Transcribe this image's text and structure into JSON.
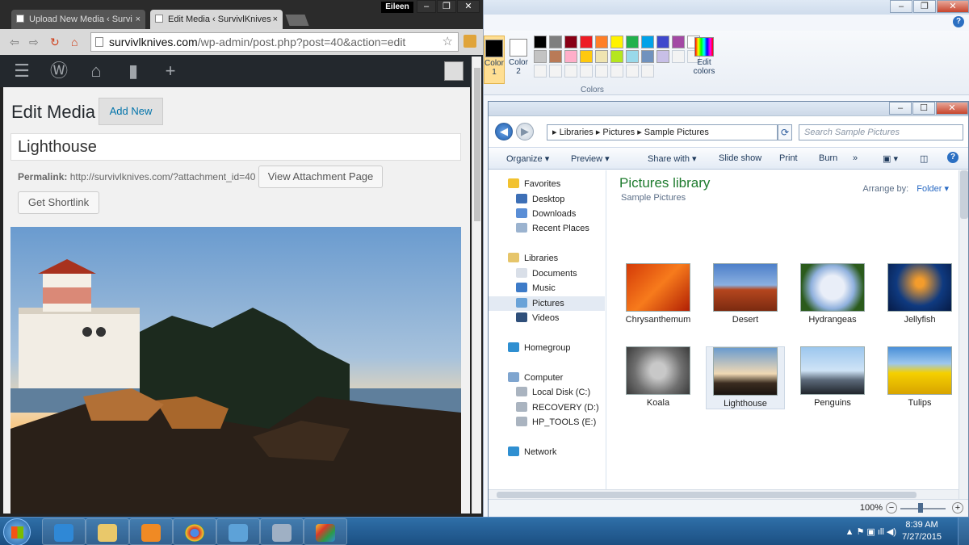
{
  "paint": {
    "color1_label": "Color 1",
    "color2_label": "Color 2",
    "edit_colors_label": "Edit colors",
    "group_label": "Colors",
    "palette": [
      "#000000",
      "#7f7f7f",
      "#880015",
      "#ed1c24",
      "#ff7f27",
      "#fff200",
      "#22b14c",
      "#00a2e8",
      "#3f48cc",
      "#a349a4",
      "#ffffff",
      "#c3c3c3",
      "#b97a57",
      "#ffaec9",
      "#ffc90e",
      "#efe4b0",
      "#b5e61d",
      "#99d9ea",
      "#7092be",
      "#c8bfe7",
      "#f3f3f3",
      "#f3f3f3",
      "#f3f3f3",
      "#f3f3f3",
      "#f3f3f3",
      "#f3f3f3",
      "#f3f3f3",
      "#f3f3f3",
      "#f3f3f3",
      "#f3f3f3"
    ],
    "help_label": "?"
  },
  "explorer": {
    "breadcrumb": "▸  Libraries  ▸  Pictures  ▸  Sample Pictures",
    "search_placeholder": "Search Sample Pictures",
    "toolbar": {
      "organize": "Organize ▾",
      "preview": "Preview ▾",
      "share": "Share with ▾",
      "slideshow": "Slide show",
      "print": "Print",
      "burn": "Burn",
      "more": "»"
    },
    "nav": [
      {
        "label": "Favorites",
        "color": "#f2c230"
      },
      {
        "label": "Desktop",
        "color": "#3d6fb6"
      },
      {
        "label": "Downloads",
        "color": "#5a8ed6"
      },
      {
        "label": "Recent Places",
        "color": "#9bb3cf"
      },
      {
        "label": "Libraries",
        "color": "#e6c56a"
      },
      {
        "label": "Documents",
        "color": "#d9dfe8"
      },
      {
        "label": "Music",
        "color": "#3d7bc8"
      },
      {
        "label": "Pictures",
        "color": "#6aa3d8"
      },
      {
        "label": "Videos",
        "color": "#2f4f7a"
      },
      {
        "label": "Homegroup",
        "color": "#2f8fd1"
      },
      {
        "label": "Computer",
        "color": "#7fa5cf"
      },
      {
        "label": "Local Disk (C:)",
        "color": "#aab4c0"
      },
      {
        "label": "RECOVERY (D:)",
        "color": "#aab4c0"
      },
      {
        "label": "HP_TOOLS (E:)",
        "color": "#aab4c0"
      },
      {
        "label": "Network",
        "color": "#2f8fd1"
      }
    ],
    "library_title": "Pictures library",
    "library_subtitle": "Sample Pictures",
    "arrange_label": "Arrange by:",
    "arrange_value": "Folder ▾",
    "thumbnails": [
      {
        "label": "Chrysanthemum",
        "bg": "linear-gradient(135deg,#d43a08,#f77b1c,#b11f04)"
      },
      {
        "label": "Desert",
        "bg": "linear-gradient(#4d7fc9 0%,#8bb0e0 45%,#b5461e 55%,#7b2a10 100%)"
      },
      {
        "label": "Hydrangeas",
        "bg": "radial-gradient(circle,#e9eef8 30%,#8fb0dd 55%,#2b5b1c 80%)"
      },
      {
        "label": "Jellyfish",
        "bg": "radial-gradient(circle at 50% 40%,#f39c2c 10%,#0f3a80 55%,#061a45 100%)"
      },
      {
        "label": "Koala",
        "bg": "radial-gradient(circle at 50% 50%,#c8c8c8 20%,#6f6f6f 60%,#3a3a3a 100%)"
      },
      {
        "label": "Lighthouse",
        "bg": "linear-gradient(#6a9bcf 0%,#f0d9b4 55%,#3a2c20 75%,#1b1510 100%)"
      },
      {
        "label": "Penguins",
        "bg": "linear-gradient(#9cc7ee 0%,#cfe3f6 50%,#5c6a7a 70%,#20252c 100%)"
      },
      {
        "label": "Tulips",
        "bg": "linear-gradient(#4a8fd8 0%,#9cc7ee 35%,#f5d000 55%,#d8a400 100%)"
      }
    ],
    "zoom_label": "100%"
  },
  "chrome": {
    "tab1": "Upload New Media ‹ Survi",
    "tab2": "Edit Media ‹ SurvivlKnives",
    "tab_close": "×",
    "user": "Eileen",
    "url_host": "survivlknives.com",
    "url_path": "/wp-admin/post.php?post=40&action=edit"
  },
  "wp": {
    "page_title": "Edit Media",
    "add_new": "Add New",
    "title_value": "Lighthouse",
    "permalink_label": "Permalink:",
    "permalink_url": "http://survivlknives.com/?attachment_id=40",
    "view_attachment": "View Attachment Page",
    "get_shortlink": "Get Shortlink"
  },
  "taskbar": {
    "time": "8:39 AM",
    "date": "7/27/2015",
    "tray_icons": "▲  ⚑  ▣  ıll  ◀)"
  }
}
